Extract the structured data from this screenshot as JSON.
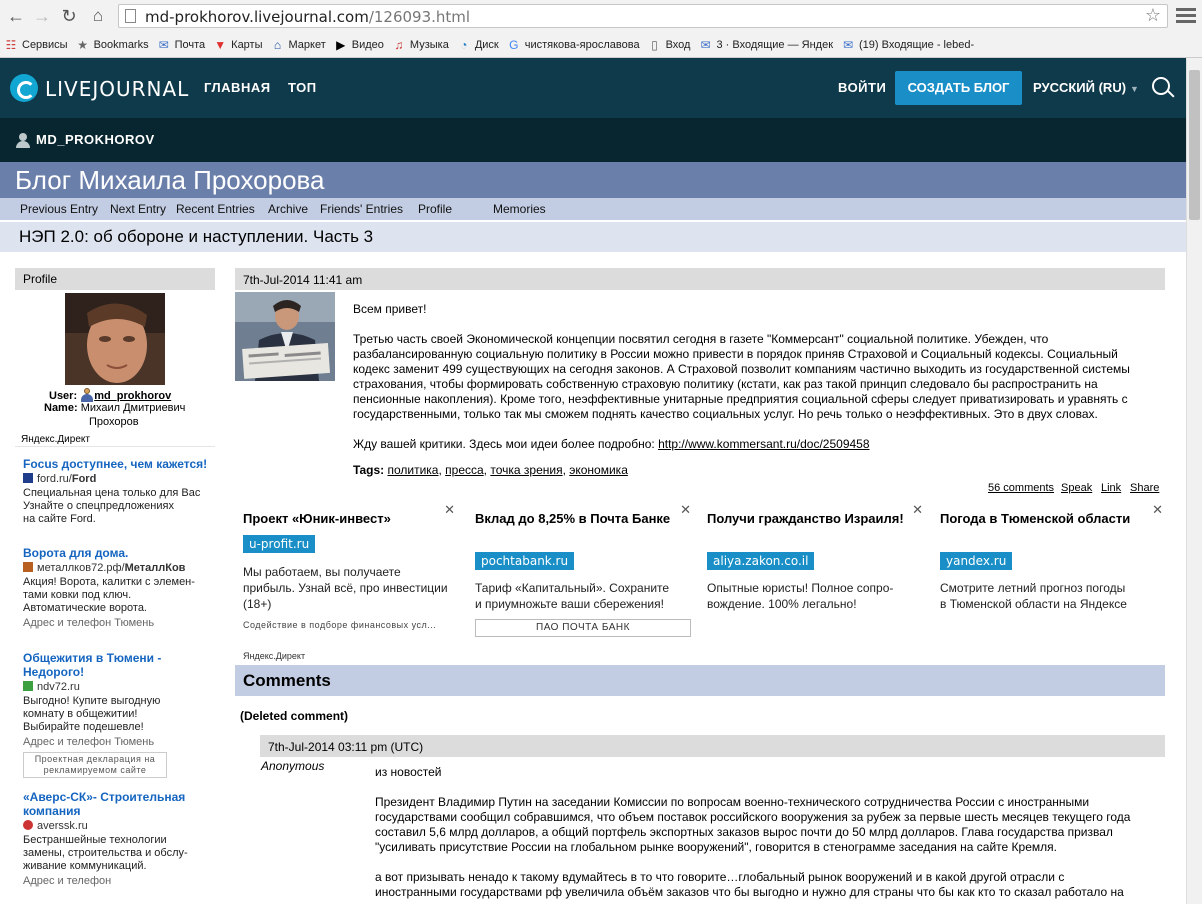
{
  "browser": {
    "url_domain": "md-prokhorov.livejournal.com",
    "url_path": "/126093.html",
    "bookmarks": [
      {
        "label": "Сервисы",
        "icon": "apps-grid-icon"
      },
      {
        "label": "Bookmarks",
        "icon": "star-icon"
      },
      {
        "label": "Почта",
        "icon": "mail-icon"
      },
      {
        "label": "Карты",
        "icon": "map-pin-icon"
      },
      {
        "label": "Маркет",
        "icon": "cart-icon"
      },
      {
        "label": "Видео",
        "icon": "video-icon"
      },
      {
        "label": "Музыка",
        "icon": "music-icon"
      },
      {
        "label": "Диск",
        "icon": "disk-icon"
      },
      {
        "label": "чистякова-ярославова",
        "icon": "google-icon"
      },
      {
        "label": "Вход",
        "icon": "page-icon"
      },
      {
        "label": "3 · Входящие — Яндек",
        "icon": "mail-icon"
      },
      {
        "label": "(19) Входящие - lebed-",
        "icon": "mail-icon"
      }
    ]
  },
  "lj": {
    "logo": "LIVEJOURNAL",
    "nav": [
      "ГЛАВНАЯ",
      "ТОП"
    ],
    "login": "ВОЙТИ",
    "create_blog": "СОЗДАТЬ БЛОГ",
    "language": "РУССКИЙ (RU)",
    "username": "MD_PROKHOROV"
  },
  "blog": {
    "title": "Блог Михаила Прохорова",
    "nav": [
      "Previous Entry",
      "Next Entry",
      "Recent Entries",
      "Archive",
      "Friends' Entries",
      "Profile",
      "Memories"
    ],
    "subject": "НЭП 2.0: об обороне и наступлении. Часть 3"
  },
  "profile": {
    "heading": "Profile",
    "user_label": "User:",
    "user": "md_prokhorov",
    "name_label": "Name:",
    "name_line1": "Михаил Дмитриевич",
    "name_line2": "Прохоров"
  },
  "left_ads": {
    "tag": "Яндекс.Директ",
    "items": [
      {
        "title": "Focus доступнее, чем кажется!",
        "domain_plain": "ford.ru/",
        "domain_bold": "Ford",
        "text": [
          "Специальная цена только для Вас",
          "Узнайте о спецпредложениях",
          "на сайте Ford."
        ],
        "links": ""
      },
      {
        "title": "Ворота для дома.",
        "domain_plain": "металлков72.рф/",
        "domain_bold": "МеталлКов",
        "text": [
          "Акция! Ворота, калитки с элемен-",
          "тами ковки под ключ.",
          "Автоматические ворота."
        ],
        "links": "Адрес и телефон   Тюмень"
      },
      {
        "title": "Общежития в Тюмени - Недорого!",
        "domain_plain": "ndv72.ru",
        "domain_bold": "",
        "text": [
          "Выгодно! Купите выгодную",
          "комнату в общежитии!",
          "Выбирайте подешевле!"
        ],
        "links": "Адрес и телефон   Тюмень",
        "declaration": "Проектная декларация на рекламируемом сайте"
      },
      {
        "title": "«Аверс-СК»- Строительная компания",
        "domain_plain": "averssk.ru",
        "domain_bold": "",
        "text": [
          "Бестраншейные технологии",
          "замены, строительства и обслу-",
          "живание коммуникаций."
        ],
        "links": "Адрес и телефон"
      }
    ]
  },
  "entry": {
    "date": "7th-Jul-2014 11:41 am",
    "greeting": "Всем привет!",
    "paragraph1": [
      "Третью часть своей Экономической концепции посвятил сегодня в газете \"Коммерсант\" социальной политике. Убежден, что",
      "разбалансированную социальную политику в России можно привести в порядок приняв Страховой и Социальный кодексы. Социальный",
      "кодекс заменит 499 существующих на сегодня законов. А Страховой позволит компаниям частично выходить из государственной системы",
      "страхования, чтобы формировать собственную страховую политику (кстати, как раз такой принцип следовало бы распространить на",
      "пенсионные накопления). Кроме того, неэффективные унитарные предприятия социальной сферы следует приватизировать и уравнять с",
      "государственными, только так мы сможем поднять качество социальных услуг. Но речь только о неэффективных. Это в двух словах."
    ],
    "critique": "Жду вашей критики. Здесь мои идеи более подробно: ",
    "link": "http://www.kommersant.ru/doc/2509458",
    "tags_label": "Tags:",
    "tags": [
      "политика",
      "пресса",
      "точка зрения",
      "экономика"
    ],
    "actions": [
      "56 comments",
      "Speak",
      "Link",
      "Share"
    ]
  },
  "ads_row": [
    {
      "title": "Проект «Юник-инвест»",
      "domain": "u-profit.ru",
      "desc": [
        "Мы работаем, вы получаете",
        "прибыль. Узнай всё, про инвестиции",
        "(18+)"
      ],
      "small": "Содействие в подборе финансовых усл..."
    },
    {
      "title": "Вклад до 8,25% в Почта Банке",
      "domain": "pochtabank.ru",
      "desc": [
        "Тариф «Капитальный». Сохраните",
        "и приумножьте ваши сбережения!"
      ],
      "button": "ПАО ПОЧТА БАНК"
    },
    {
      "title": "Получи гражданство Израиля!",
      "domain": "aliya.zakon.co.il",
      "desc": [
        "Опытные юристы! Полное сопро-",
        "вождение. 100% легально!"
      ]
    },
    {
      "title": "Погода в Тюменской области",
      "domain": "yandex.ru",
      "desc": [
        "Смотрите летний прогноз погоды",
        "в Тюменской области на Яндексе"
      ]
    }
  ],
  "ads_row_tag": "Яндекс.Директ",
  "comments": {
    "heading": "Comments",
    "deleted": "(Deleted comment)",
    "date": "7th-Jul-2014 03:11 pm (UTC)",
    "author": "Anonymous",
    "line1": "из новостей",
    "paragraph": [
      "Президент Владимир Путин на заседании Комиссии по вопросам военно-технического сотрудничества России с иностранными",
      "государствами сообщил собравшимся, что объем поставок российского вооружения за рубеж за первые шесть месяцев текущего года",
      "составил 5,6 млрд долларов, а общий портфель экспортных заказов вырос почти до 50 млрд долларов. Глава государства призвал",
      "\"усиливать присутствие России на глобальном рынке вооружений\", говорится в стенограмме заседания на сайте Кремля."
    ],
    "paragraph2": [
      "а вот призывать ненадо к такому вдумайтесь в то что говорите…глобальный рынок вооружений и в какой другой отрасли с",
      "иностранными государствами рф увеличила объём заказов что бы выгодно и нужно для страны что бы как кто то сказал работало на"
    ]
  }
}
